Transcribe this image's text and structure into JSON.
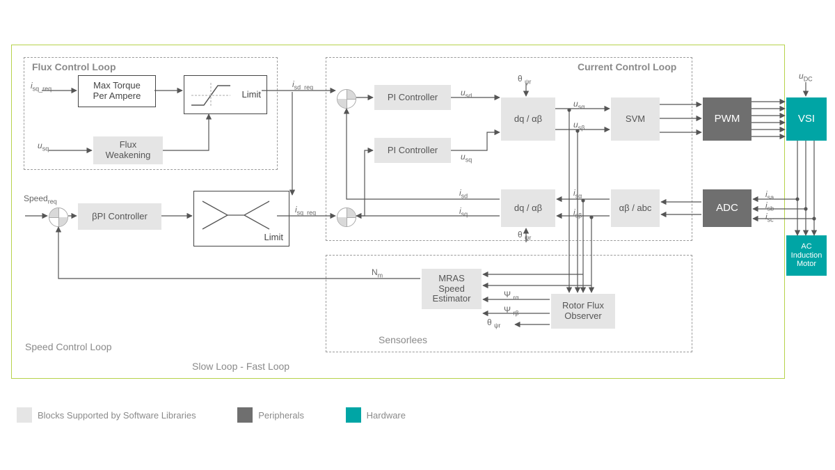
{
  "sections": {
    "flux": "Flux Control Loop",
    "current": "Current Control Loop",
    "speed": "Speed Control Loop",
    "sensorless": "Sensorlees",
    "slowfast": "Slow Loop - Fast Loop"
  },
  "blocks": {
    "mtpa": "Max Torque\nPer Ampere",
    "limit": "Limit",
    "fluxweak": "Flux\nWeakening",
    "bpi": "βPI Controller",
    "limit2": "Limit",
    "pi1": "PI Controller",
    "pi2": "PI Controller",
    "dqab1": "dq / αβ",
    "dqab2": "dq / αβ",
    "svm": "SVM",
    "pwm": "PWM",
    "vsi": "VSI",
    "abab": "αβ / abc",
    "adc": "ADC",
    "mras": "MRAS\nSpeed\nEstimator",
    "rfo": "Rotor Flux\nObserver",
    "acm": "AC\nInduction\nMotor"
  },
  "signals": {
    "isq_req_in": "i<sub>sq_req</sub>",
    "usq_in": "u<sub>sq</sub>",
    "isd_req": "i<sub>sd_req</sub>",
    "speed_req": "Speed<sub>req</sub>",
    "isq_req": "i<sub>sq_req</sub>",
    "usd": "u<sub>sd</sub>",
    "usq": "u<sub>sq</sub>",
    "usa": "u<sub>sα</sub>",
    "usb": "u<sub>sβ</sub>",
    "theta1": "θ <sub>ψr</sub>",
    "isd": "i<sub>sd</sub>",
    "isq": "i<sub>sq</sub>",
    "isa": "i<sub>sα</sub>",
    "isb": "i<sub>sβ</sub>",
    "theta2": "θ <sub>ψr</sub>",
    "isa_p": "i<sub>sa</sub>",
    "isb_p": "i<sub>sb</sub>",
    "isc_p": "i<sub>sc</sub>",
    "udc": "u<sub>DC</sub>",
    "nm": "N<sub>m</sub>",
    "psira": "Ψ <sub>rα</sub>",
    "psirb": "Ψ <sub>rβ</sub>",
    "theta3": "θ <sub>ψr</sub>"
  },
  "legend": {
    "sw": "Blocks Supported by Software Libraries",
    "per": "Peripherals",
    "hw": "Hardware"
  }
}
